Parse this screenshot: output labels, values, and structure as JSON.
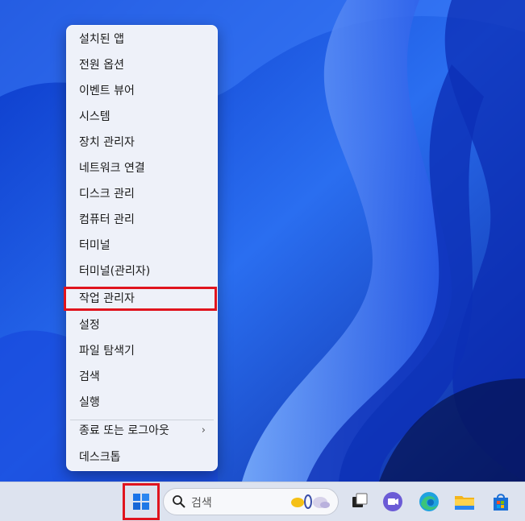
{
  "menu": {
    "items": [
      {
        "label": "설치된 앱"
      },
      {
        "label": "전원 옵션"
      },
      {
        "label": "이벤트 뷰어"
      },
      {
        "label": "시스템"
      },
      {
        "label": "장치 관리자"
      },
      {
        "label": "네트워크 연결"
      },
      {
        "label": "디스크 관리"
      },
      {
        "label": "컴퓨터 관리"
      },
      {
        "label": "터미널"
      },
      {
        "label": "터미널(관리자)"
      },
      {
        "label": "작업 관리자",
        "highlighted": true
      },
      {
        "label": "설정"
      },
      {
        "label": "파일 탐색기"
      },
      {
        "label": "검색"
      },
      {
        "label": "실행"
      },
      {
        "label": "종료 또는 로그아웃",
        "submenu": true
      },
      {
        "label": "데스크톱"
      }
    ],
    "submenu_chevron": "›"
  },
  "taskbar": {
    "search_label": "검색",
    "icons": [
      "windows-start-icon",
      "search-icon",
      "widgets-icon",
      "task-view-icon",
      "chat-icon",
      "edge-icon",
      "file-explorer-icon",
      "store-icon"
    ]
  },
  "colors": {
    "highlight": "#e0141e",
    "menu_bg": "#eef1f9",
    "taskbar_bg": "#dde3ef",
    "wallpaper": "#1f4fd8"
  }
}
